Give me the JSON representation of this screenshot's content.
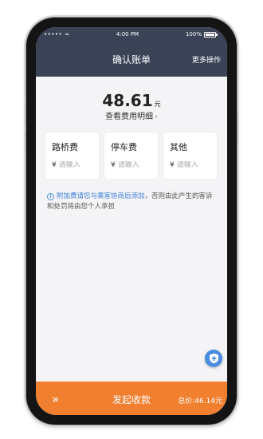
{
  "status": {
    "signal": "•••••",
    "wifi": "≈",
    "time": "4:00 PM",
    "battery": "100%"
  },
  "nav": {
    "title": "确认账单",
    "more": "更多操作"
  },
  "amount": {
    "value": "48.61",
    "unit": "元",
    "detail_link": "查看费用明细",
    "detail_chevron": "›"
  },
  "cards": [
    {
      "title": "路桥费",
      "currency": "¥",
      "placeholder": "请输入"
    },
    {
      "title": "停车费",
      "currency": "¥",
      "placeholder": "请输入"
    },
    {
      "title": "其他",
      "currency": "¥",
      "placeholder": "请输入"
    }
  ],
  "notice": {
    "icon": "i",
    "highlight": "附加费请您与乘客协商后添加",
    "rest": "，否则由此产生的客诉和处罚将由您个人承担"
  },
  "bottom": {
    "swipe_icon": "»",
    "collect_label": "发起收款",
    "total": "总价:46.14元"
  },
  "colors": {
    "header_bg": "#3a4256",
    "accent_orange": "#f08030",
    "link_blue": "#3d7fdc"
  }
}
